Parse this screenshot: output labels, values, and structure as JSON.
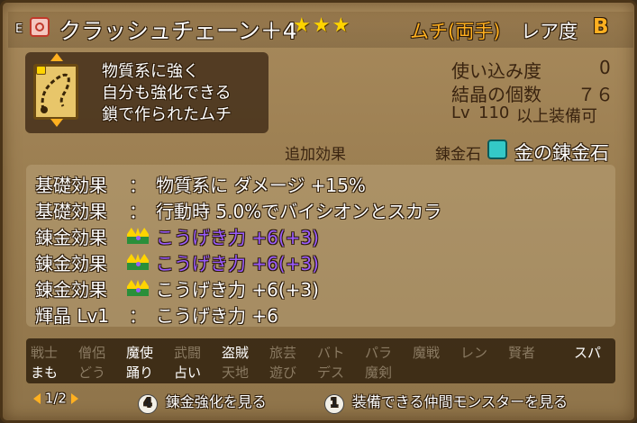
{
  "header": {
    "equip_mark": "E",
    "item_name": "クラッシュチェーン＋4",
    "stars": "★★★",
    "item_type": "ムチ(両手)",
    "rarity_label": "レア度",
    "rarity_value": "B"
  },
  "item": {
    "icon_name": "chain-whip-icon",
    "description": [
      "物質系に強く",
      "自分も強化できる",
      "鎖で作られたムチ"
    ]
  },
  "stats": {
    "usage_label": "使い込み度",
    "usage_value": "0",
    "crystal_label": "結晶の個数",
    "crystal_value": "７６",
    "level_prefix": "Lv",
    "level_value": "110",
    "level_suffix": "以上装備可"
  },
  "alchemy": {
    "extra_effects_label": "追加効果",
    "alchemy_stone_label": "錬金石",
    "alchemy_stone_value": "金の錬金石"
  },
  "effects": [
    {
      "label": "基礎効果",
      "colon": "：",
      "text": "物質系に ダメージ +15%",
      "crown": false,
      "purple": false
    },
    {
      "label": "基礎効果",
      "colon": "：",
      "text": "行動時 5.0%でバイシオンとスカラ",
      "crown": false,
      "purple": false
    },
    {
      "label": "錬金効果",
      "colon": "",
      "text": "こうげき力 +6(+3)",
      "crown": true,
      "purple": true
    },
    {
      "label": "錬金効果",
      "colon": "",
      "text": "こうげき力 +6(+3)",
      "crown": true,
      "purple": true
    },
    {
      "label": "錬金効果",
      "colon": "",
      "text": "こうげき力 +6(+3)",
      "crown": true,
      "purple": false
    },
    {
      "label": "輝晶 Lv1",
      "colon": "：",
      "text": "こうげき力 +6",
      "crown": false,
      "purple": false
    }
  ],
  "jobs_row1": [
    {
      "name": "戦士",
      "on": false
    },
    {
      "name": "僧侶",
      "on": false
    },
    {
      "name": "魔使",
      "on": true
    },
    {
      "name": "武闘",
      "on": false
    },
    {
      "name": "盗賊",
      "on": true
    },
    {
      "name": "旅芸",
      "on": false
    },
    {
      "name": "バト",
      "on": false
    },
    {
      "name": "パラ",
      "on": false
    },
    {
      "name": "魔戦",
      "on": false
    },
    {
      "name": "レン",
      "on": false
    },
    {
      "name": "賢者",
      "on": false
    },
    {
      "name": "スパ",
      "on": true
    }
  ],
  "jobs_row2": [
    {
      "name": "まも",
      "on": true
    },
    {
      "name": "どう",
      "on": false
    },
    {
      "name": "踊り",
      "on": true
    },
    {
      "name": "占い",
      "on": true
    },
    {
      "name": "天地",
      "on": false
    },
    {
      "name": "遊び",
      "on": false
    },
    {
      "name": "デス",
      "on": false
    },
    {
      "name": "魔剣",
      "on": false
    }
  ],
  "footer": {
    "page": "1/2",
    "btn4_key": "4",
    "btn4_label": "錬金強化を見る",
    "btn1_key": "1",
    "btn1_label": "装備できる仲間モンスターを見る"
  },
  "colors": {
    "accent_orange": "#ffb020",
    "alchemy_purple": "#9b5cff",
    "star_yellow": "#ffd400"
  }
}
